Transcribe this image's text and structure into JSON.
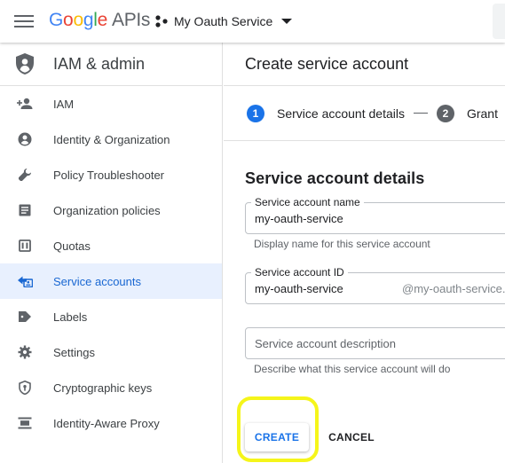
{
  "topbar": {
    "logo_google": [
      "G",
      "o",
      "o",
      "g",
      "l",
      "e"
    ],
    "logo_apis": "APIs",
    "project_name": "My Oauth Service"
  },
  "sidebar": {
    "title": "IAM & admin",
    "items": [
      {
        "label": "IAM",
        "icon": "person-add-icon"
      },
      {
        "label": "Identity & Organization",
        "icon": "account-circle-icon"
      },
      {
        "label": "Policy Troubleshooter",
        "icon": "wrench-icon"
      },
      {
        "label": "Organization policies",
        "icon": "document-icon"
      },
      {
        "label": "Quotas",
        "icon": "quota-icon"
      },
      {
        "label": "Service accounts",
        "icon": "service-account-icon",
        "active": true
      },
      {
        "label": "Labels",
        "icon": "label-icon"
      },
      {
        "label": "Settings",
        "icon": "gear-icon"
      },
      {
        "label": "Cryptographic keys",
        "icon": "key-shield-icon"
      },
      {
        "label": "Identity-Aware Proxy",
        "icon": "proxy-icon"
      }
    ]
  },
  "main": {
    "title": "Create service account",
    "steps": [
      {
        "number": "1",
        "label": "Service account details",
        "active": true
      },
      {
        "number": "2",
        "label": "Grant",
        "active": false
      }
    ],
    "section_title": "Service account details",
    "fields": {
      "name": {
        "label": "Service account name",
        "value": "my-oauth-service",
        "hint": "Display name for this service account"
      },
      "id": {
        "label": "Service account ID",
        "value": "my-oauth-service",
        "suffix": "@my-oauth-service.i"
      },
      "description": {
        "placeholder": "Service account description",
        "hint": "Describe what this service account will do"
      }
    },
    "create_label": "CREATE",
    "cancel_label": "CANCEL"
  },
  "colors": {
    "accent": "#1a73e8",
    "active_nav_bg": "#e8f0fe",
    "highlight": "#f5f51a"
  }
}
